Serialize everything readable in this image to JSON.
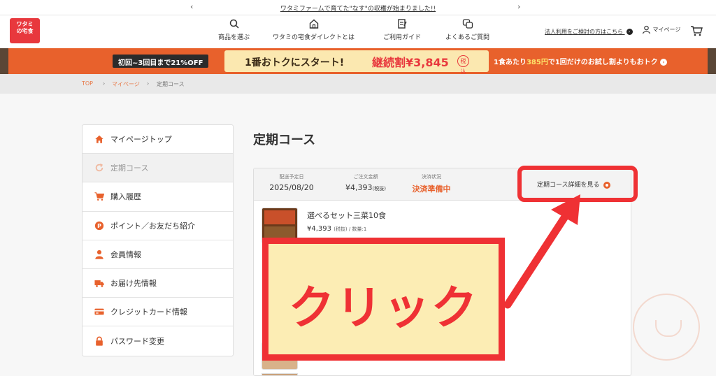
{
  "notice": {
    "text": "ワタミファームで育てた\"なす\"の収穫が始まりました!!",
    "prev_icon": "chevron-left-icon",
    "next_icon": "chevron-right-icon"
  },
  "header": {
    "logo_line1": "ワタミ",
    "logo_line2": "の宅食",
    "nav": [
      {
        "label": "商品を選ぶ",
        "icon": "search-icon"
      },
      {
        "label": "ワタミの宅食ダイレクトとは",
        "icon": "home-icon"
      },
      {
        "label": "ご利用ガイド",
        "icon": "guide-icon"
      },
      {
        "label": "よくあるご質問",
        "icon": "faq-icon"
      }
    ],
    "corp_link": "法人利用をご検討の方はこちら",
    "mypage": "マイページ"
  },
  "banner": {
    "pill": "初回~3回目まで21%OFF",
    "headline": "1番おトクにスタート!",
    "price": "継続割¥3,845",
    "tax_mark": "税込",
    "right_a": "1食あたり",
    "right_b": "385円",
    "right_c": "で1回だけのお試し割よりもおトク"
  },
  "breadcrumb": {
    "top": "TOP",
    "mypage": "マイページ",
    "current": "定期コース"
  },
  "sidebar": {
    "items": [
      {
        "label": "マイページトップ",
        "icon": "home-icon"
      },
      {
        "label": "定期コース",
        "icon": "refresh-icon"
      },
      {
        "label": "購入履歴",
        "icon": "cart-icon"
      },
      {
        "label": "ポイント／お友だち紹介",
        "icon": "point-icon"
      },
      {
        "label": "会員情報",
        "icon": "user-icon"
      },
      {
        "label": "お届け先情報",
        "icon": "truck-icon"
      },
      {
        "label": "クレジットカード情報",
        "icon": "credit-card-icon"
      },
      {
        "label": "パスワード変更",
        "icon": "lock-icon"
      }
    ]
  },
  "main": {
    "title": "定期コース",
    "order": {
      "delivery_label": "配送予定日",
      "delivery_value": "2025/08/20",
      "amount_label": "ご注文金額",
      "amount_value": "¥4,393",
      "amount_tax": "(税抜)",
      "status_label": "決済状況",
      "status_value": "決済準備中",
      "detail_link": "定期コース詳細を見る",
      "item_name": "選べるセット三菜10食",
      "item_price": "¥4,393",
      "item_tax_qty": "(税抜) / 数量:1"
    }
  },
  "annotation": {
    "text": "クリック"
  },
  "colors": {
    "brand_red": "#e8383d",
    "banner_orange": "#e8612c",
    "annotation_red": "#ef3134",
    "annotation_fill": "#fcedb4"
  }
}
